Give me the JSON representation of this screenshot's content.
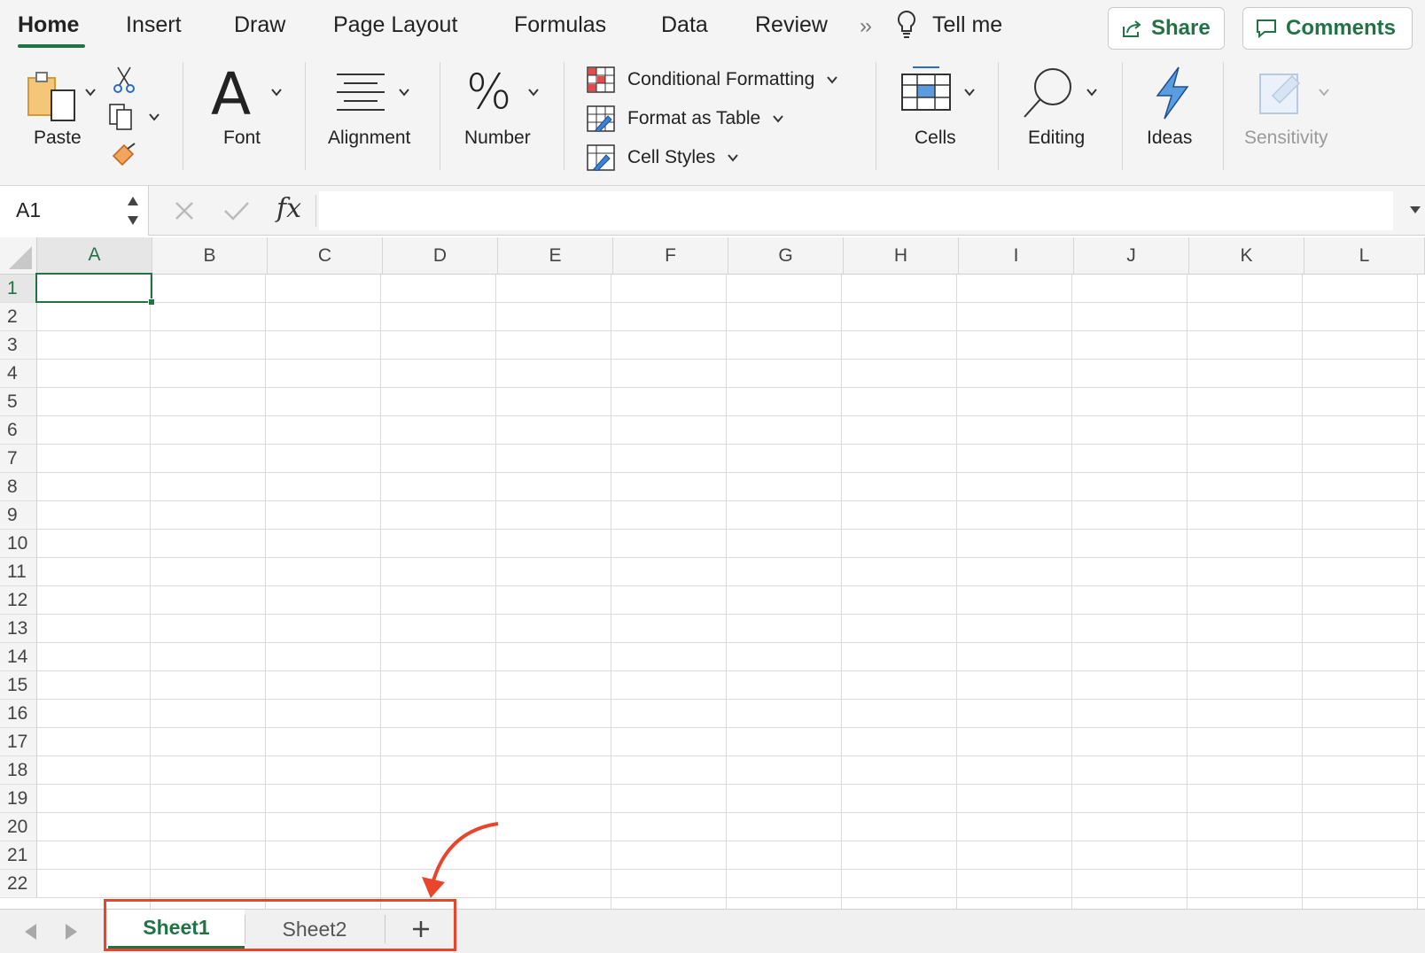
{
  "tabs": [
    {
      "label": "Home",
      "active": true
    },
    {
      "label": "Insert"
    },
    {
      "label": "Draw"
    },
    {
      "label": "Page Layout"
    },
    {
      "label": "Formulas"
    },
    {
      "label": "Data"
    },
    {
      "label": "Review"
    }
  ],
  "tell_me": "Tell me",
  "share_label": "Share",
  "comments_label": "Comments",
  "ribbon": {
    "paste": "Paste",
    "font": "Font",
    "alignment": "Alignment",
    "number": "Number",
    "conditional_formatting": "Conditional Formatting",
    "format_as_table": "Format as Table",
    "cell_styles": "Cell Styles",
    "cells": "Cells",
    "editing": "Editing",
    "ideas": "Ideas",
    "sensitivity": "Sensitivity"
  },
  "formula_bar": {
    "name_box": "A1",
    "fx": "fx",
    "value": ""
  },
  "grid": {
    "columns": [
      "A",
      "B",
      "C",
      "D",
      "E",
      "F",
      "G",
      "H",
      "I",
      "J",
      "K",
      "L"
    ],
    "rows": [
      "1",
      "2",
      "3",
      "4",
      "5",
      "6",
      "7",
      "8",
      "9",
      "10",
      "11",
      "12",
      "13",
      "14",
      "15",
      "16",
      "17",
      "18",
      "19",
      "20",
      "21",
      "22"
    ],
    "selected_cell": "A1"
  },
  "sheets": [
    {
      "label": "Sheet1",
      "active": true
    },
    {
      "label": "Sheet2",
      "active": false
    }
  ],
  "add_sheet_label": "+",
  "colors": {
    "accent": "#217346",
    "annotation": "#e8452c"
  }
}
